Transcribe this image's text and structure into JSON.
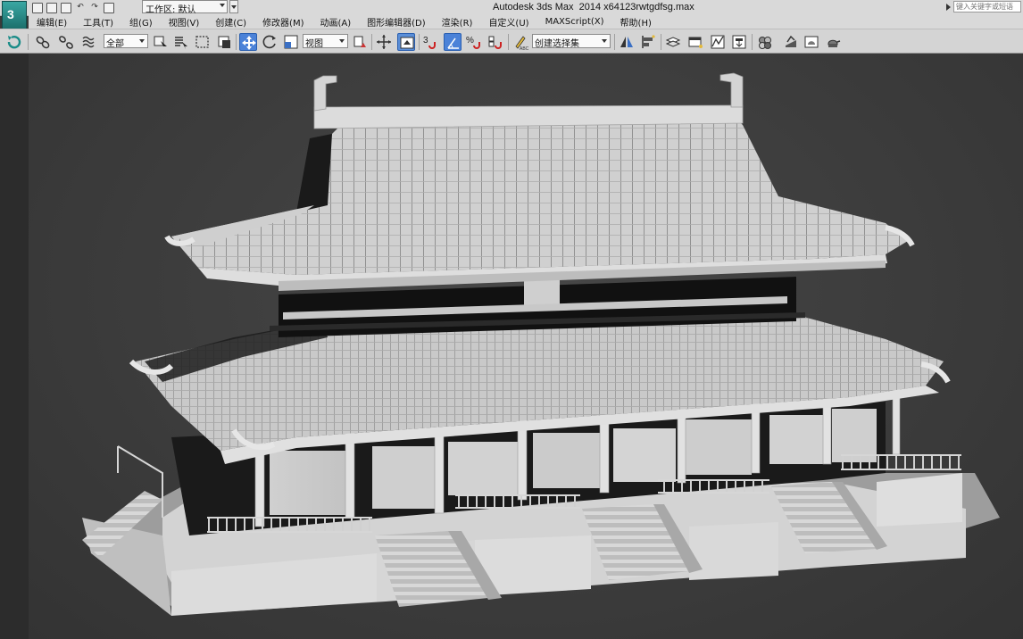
{
  "window": {
    "title": "Autodesk 3ds Max  2014 x64",
    "filename": "123rwtgdfsg.max",
    "workspace_label": "工作区: 默认",
    "search_placeholder": "键入关键字或短语"
  },
  "menu": [
    "编辑(E)",
    "工具(T)",
    "组(G)",
    "视图(V)",
    "创建(C)",
    "修改器(M)",
    "动画(A)",
    "图形编辑器(D)",
    "渲染(R)",
    "自定义(U)",
    "MAXScript(X)",
    "帮助(H)"
  ],
  "toolbar": {
    "selection_filter": "全部",
    "reference_coord": "视图",
    "snap_label": "3",
    "angle_snap_label": "%",
    "named_selection_placeholder": "创建选择集",
    "active_tool": "select-move"
  },
  "icons": {
    "logo": "3ds-max-logo-icon",
    "link": "link-icon",
    "unlink": "unlink-icon",
    "bind": "bind-space-warp-icon",
    "select": "select-object-icon",
    "select_by_name": "select-by-name-icon",
    "region": "rectangular-region-icon",
    "window_crossing": "window-crossing-icon",
    "move": "select-move-icon",
    "rotate": "select-rotate-icon",
    "scale": "select-scale-icon",
    "pivot": "pivot-center-icon",
    "manipulate": "manipulate-icon",
    "keyboard_shortcut": "keyboard-shortcut-icon",
    "snap": "snap-toggle-icon",
    "angle_snap": "angle-snap-icon",
    "percent_snap": "percent-snap-icon",
    "spinner_snap": "spinner-snap-icon",
    "edit_named_sel": "edit-named-selection-icon",
    "mirror": "mirror-icon",
    "align": "align-icon",
    "layer": "layer-manager-icon",
    "ribbon": "graphite-ribbon-icon",
    "curve_editor": "curve-editor-icon",
    "schematic": "schematic-view-icon",
    "material": "material-editor-icon",
    "render_setup": "render-setup-icon",
    "render_frame": "rendered-frame-window-icon",
    "render": "render-production-icon"
  },
  "colors": {
    "title_bg": "#d9d9d9",
    "toolbar_bg": "#d4d4d4",
    "viewport_bg": "#3b3b3b",
    "active_tool": "#4b82d8",
    "logo": "#2a8f8b"
  }
}
